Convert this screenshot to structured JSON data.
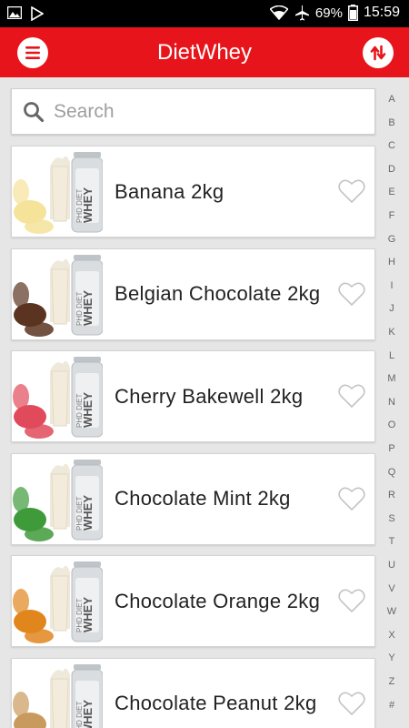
{
  "status_bar": {
    "battery": "69%",
    "time": "15:59"
  },
  "app_bar": {
    "title": "DietWhey",
    "menu_icon": "hamburger-menu-icon",
    "sort_icon": "sort-arrows-icon",
    "accent_color": "#e8141b"
  },
  "search": {
    "placeholder": "Search",
    "value": ""
  },
  "products": [
    {
      "name": "Banana 2kg",
      "favorite": false,
      "accent": "#f5e39a"
    },
    {
      "name": "Belgian Chocolate 2kg",
      "favorite": false,
      "accent": "#5a3420"
    },
    {
      "name": "Cherry Bakewell 2kg",
      "favorite": false,
      "accent": "#e04a5a"
    },
    {
      "name": "Chocolate Mint 2kg",
      "favorite": false,
      "accent": "#3f9a3a"
    },
    {
      "name": "Chocolate Orange 2kg",
      "favorite": false,
      "accent": "#e0861d"
    },
    {
      "name": "Chocolate Peanut 2kg",
      "favorite": false,
      "accent": "#c99a5e"
    }
  ],
  "alpha_index": [
    "A",
    "B",
    "C",
    "D",
    "E",
    "F",
    "G",
    "H",
    "I",
    "J",
    "K",
    "L",
    "M",
    "N",
    "O",
    "P",
    "Q",
    "R",
    "S",
    "T",
    "U",
    "V",
    "W",
    "X",
    "Y",
    "Z",
    "#"
  ]
}
